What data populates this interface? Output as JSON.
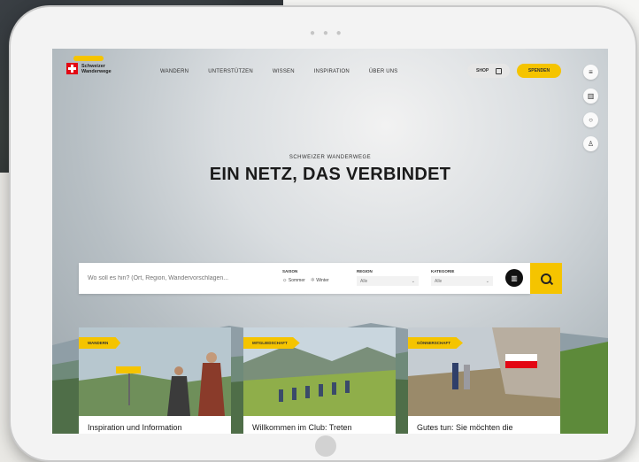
{
  "site": {
    "logo_text_line1": "Schweizer",
    "logo_text_line2": "Wanderwege"
  },
  "nav": {
    "links": [
      "WANDERN",
      "UNTERSTÜTZEN",
      "WISSEN",
      "INSPIRATION",
      "ÜBER UNS"
    ],
    "shop_label": "SHOP",
    "donate_label": "SPENDEN"
  },
  "hero": {
    "eyebrow": "SCHWEIZER WANDERWEGE",
    "headline": "EIN NETZ, DAS VERBINDET"
  },
  "search": {
    "placeholder": "Wo soll es hin? (Ort, Region, Wandervorschlagen...",
    "season_label": "SAISON",
    "season_summer": "Sommer",
    "season_winter": "Winter",
    "region_label": "REGION",
    "region_value": "Alle",
    "category_label": "KATEGORIE",
    "category_value": "Alle"
  },
  "cards": [
    {
      "tag": "WANDERN",
      "title": "Inspiration und Information"
    },
    {
      "tag": "MITGLIEDSCHAFT",
      "title": "Willkommen im Club: Treten"
    },
    {
      "tag": "GÖNNERSCHAFT",
      "title": "Gutes tun: Sie möchten die"
    }
  ],
  "colors": {
    "accent": "#f5c400",
    "swiss_red": "#e30613"
  },
  "icons": [
    "menu-icon",
    "map-icon",
    "search-icon",
    "user-icon",
    "shopping-bag-icon",
    "sun-icon",
    "snowflake-icon"
  ]
}
